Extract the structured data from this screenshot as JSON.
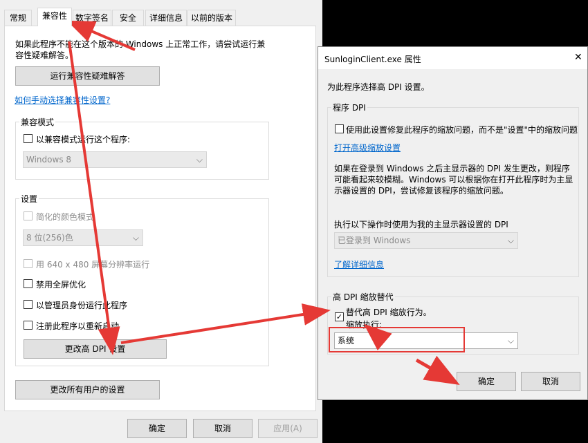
{
  "left_dialog": {
    "tabs": [
      {
        "label": "常规"
      },
      {
        "label": "兼容性"
      },
      {
        "label": "数字签名"
      },
      {
        "label": "安全"
      },
      {
        "label": "详细信息"
      },
      {
        "label": "以前的版本"
      }
    ],
    "description_line1": "如果此程序不能在这个版本的 Windows 上正常工作，请尝试运行兼",
    "description_line2": "容性疑难解答。",
    "troubleshoot_button": "运行兼容性疑难解答",
    "manual_link": "如何手动选择兼容性设置?",
    "compat_mode": {
      "title": "兼容模式",
      "checkbox_label": "以兼容模式运行这个程序:",
      "select_value": "Windows 8"
    },
    "settings": {
      "title": "设置",
      "reduced_color_label": "简化的颜色模式",
      "color_select_value": "8 位(256)色",
      "res_640_label": "用 640 x 480 屏幕分辨率运行",
      "disable_fullscreen_label": "禁用全屏优化",
      "run_as_admin_label": "以管理员身份运行此程序",
      "register_restart_label": "注册此程序以重新启动",
      "change_dpi_button": "更改高 DPI 设置"
    },
    "change_all_users_button": "更改所有用户的设置",
    "ok_button": "确定",
    "cancel_button": "取消",
    "apply_button": "应用(A)"
  },
  "right_dialog": {
    "title": "SunloginClient.exe 属性",
    "close_glyph": "✕",
    "intro": "为此程序选择高 DPI 设置。",
    "program_dpi": {
      "title": "程序 DPI",
      "checkbox_label": "使用此设置修复此程序的缩放问题，而不是\"设置\"中的缩放问题",
      "advanced_link": "打开高级缩放设置",
      "para_line1": "如果在登录到 Windows 之后主显示器的 DPI 发生更改，则程序",
      "para_line2": "可能看起来较模糊。Windows 可以根据你在打开此程序时为主显",
      "para_line3": "示器设置的 DPI，尝试修复该程序的缩放问题。",
      "use_dpi_label": "执行以下操作时使用为我的主显示器设置的 DPI",
      "select_value": "已登录到 Windows",
      "learn_more_link": "了解详细信息"
    },
    "override": {
      "title": "高 DPI 缩放替代",
      "checkbox_label": "替代高 DPI 缩放行为。",
      "performed_by_label": "缩放执行:",
      "select_value": "系统"
    },
    "ok_button": "确定",
    "cancel_button": "取消"
  },
  "annotation_color": "#e53935"
}
